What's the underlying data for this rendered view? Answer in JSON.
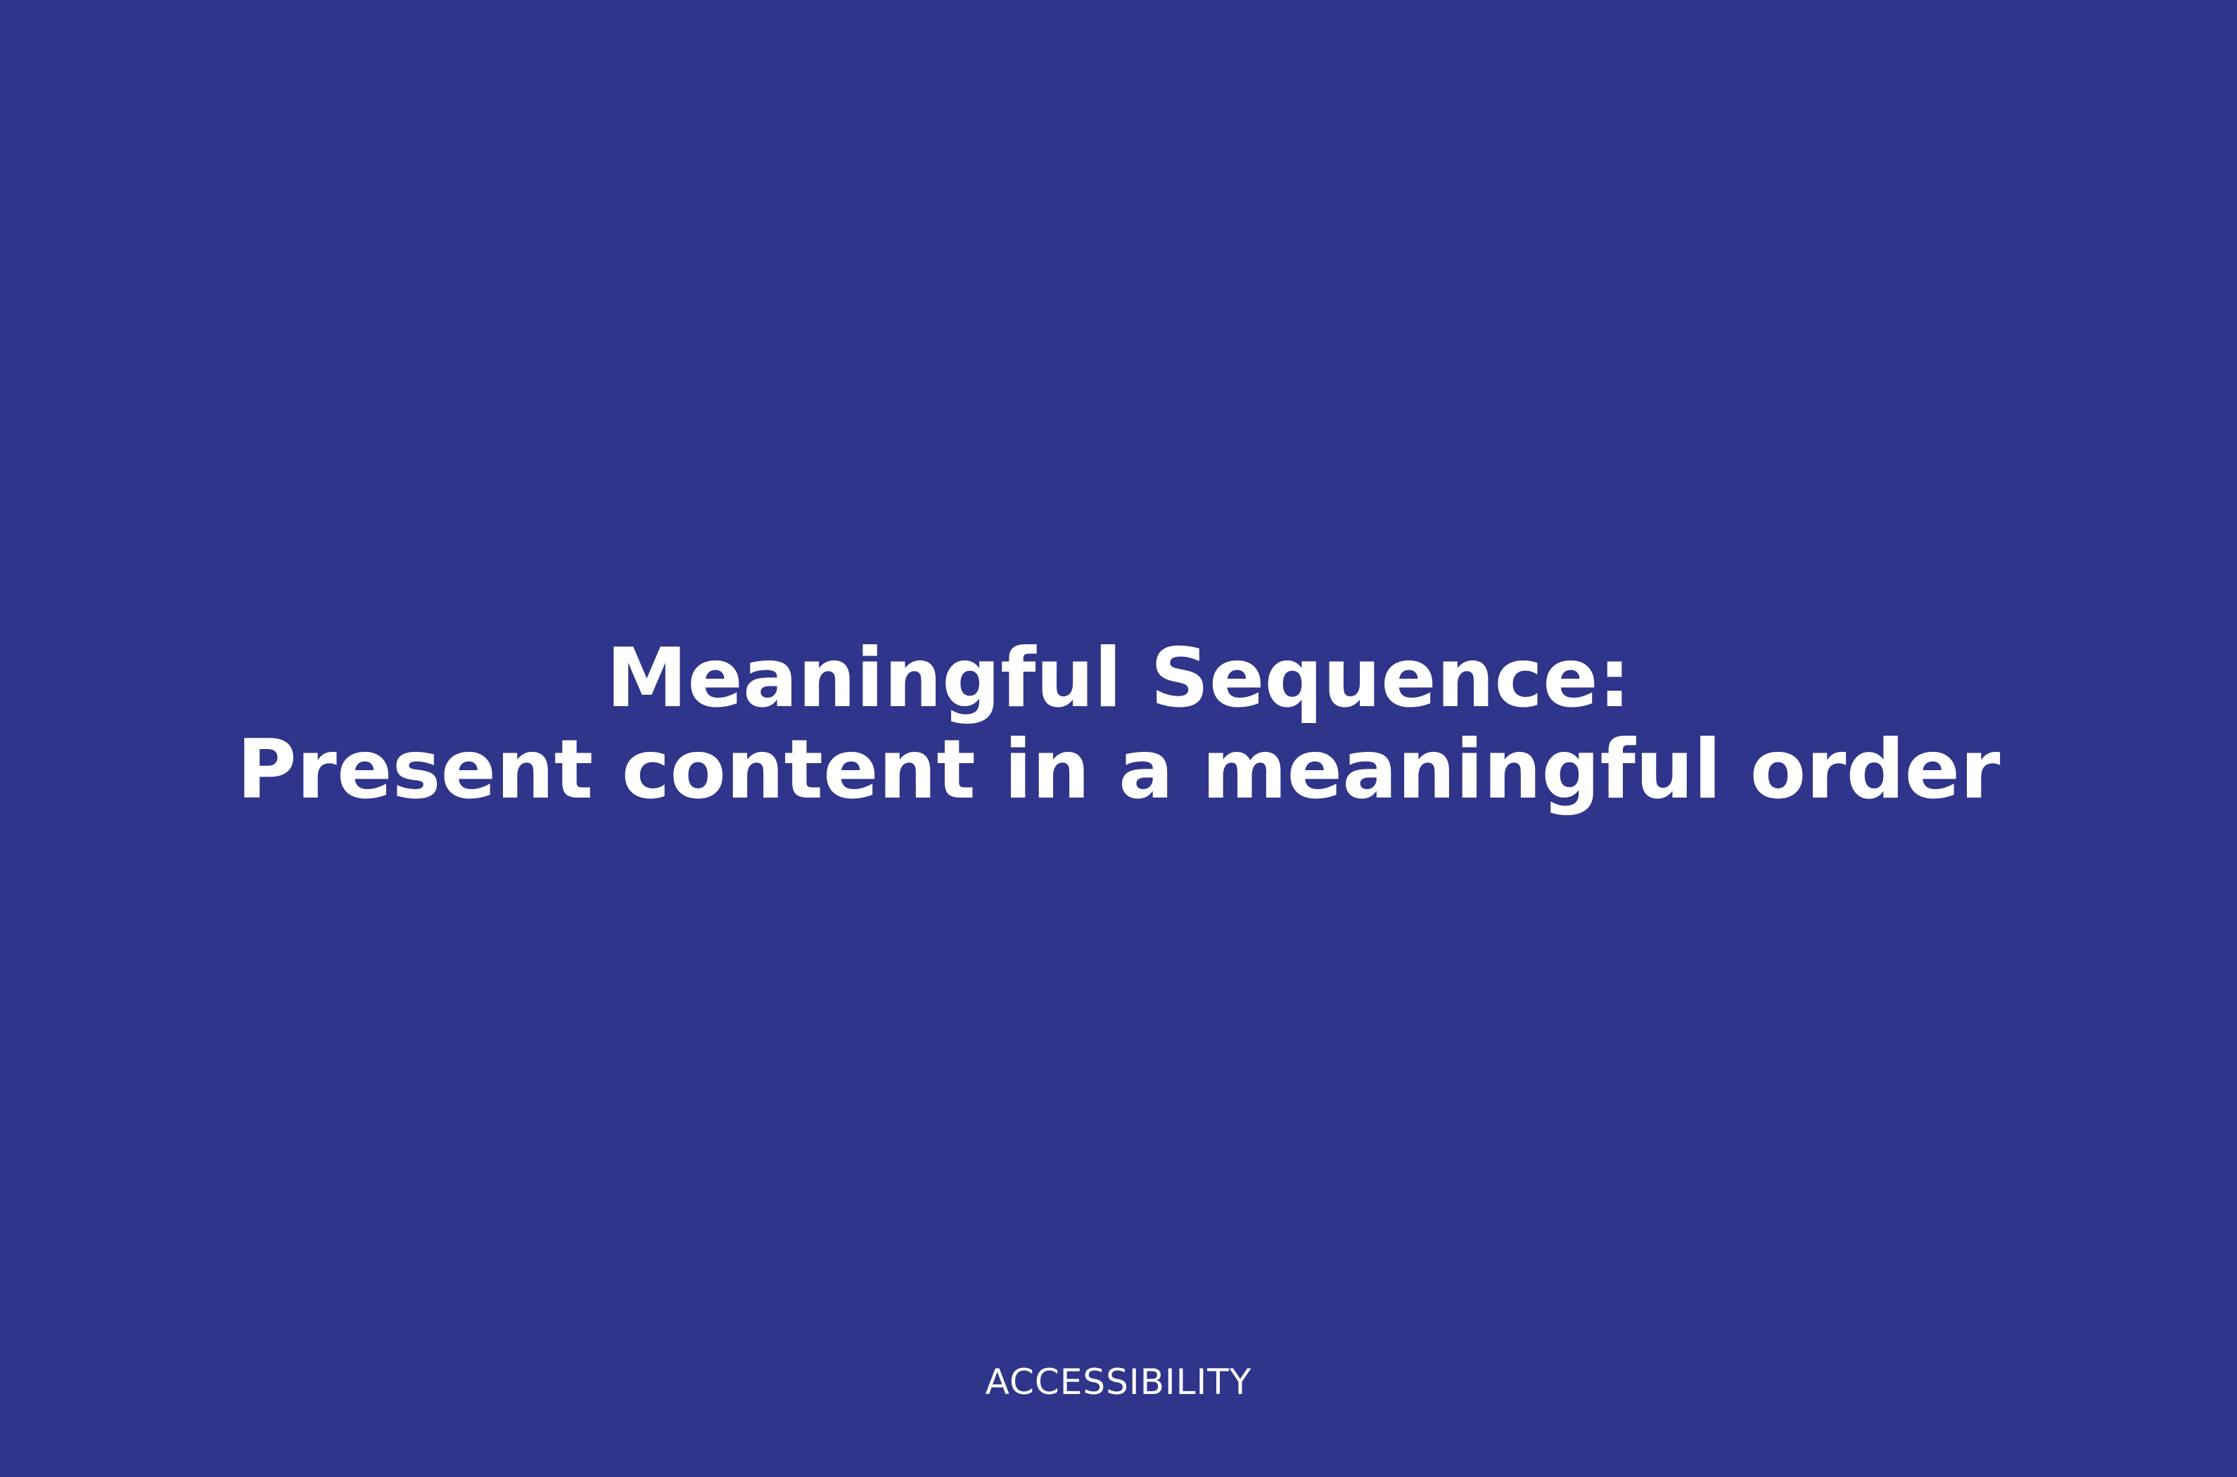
{
  "slide": {
    "title_line_1": "Meaningful Sequence:",
    "title_line_2": "Present content in a meaningful order",
    "footer": "ACCESSIBILITY"
  },
  "colors": {
    "background": "#2f358a",
    "text": "#ffffff"
  }
}
